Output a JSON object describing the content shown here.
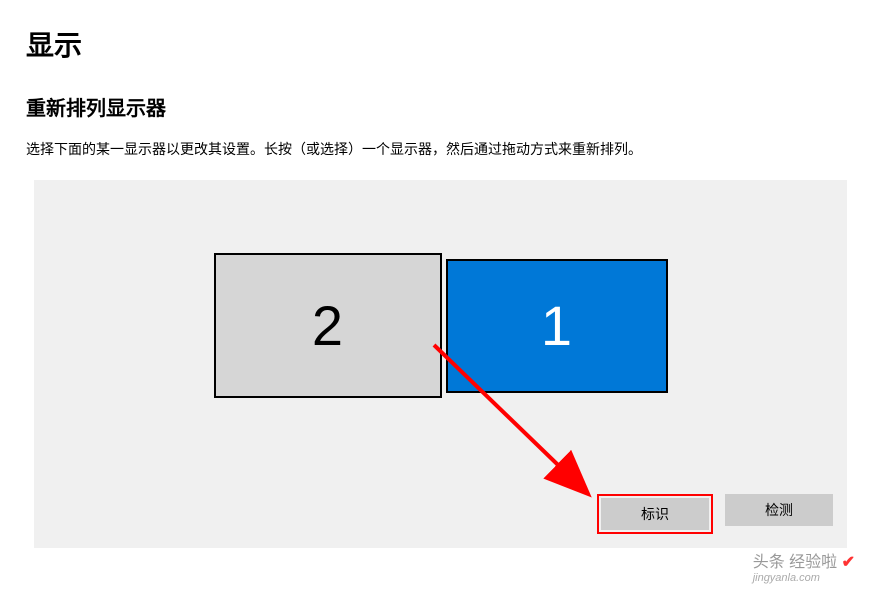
{
  "page": {
    "title": "显示",
    "section_title": "重新排列显示器",
    "description": "选择下面的某一显示器以更改其设置。长按（或选择）一个显示器，然后通过拖动方式来重新排列。"
  },
  "monitors": {
    "primary_label": "1",
    "secondary_label": "2"
  },
  "buttons": {
    "identify": "标识",
    "detect": "检测"
  },
  "watermark": {
    "line1": "头条 经验啦",
    "line2": "jingyanla.com"
  }
}
